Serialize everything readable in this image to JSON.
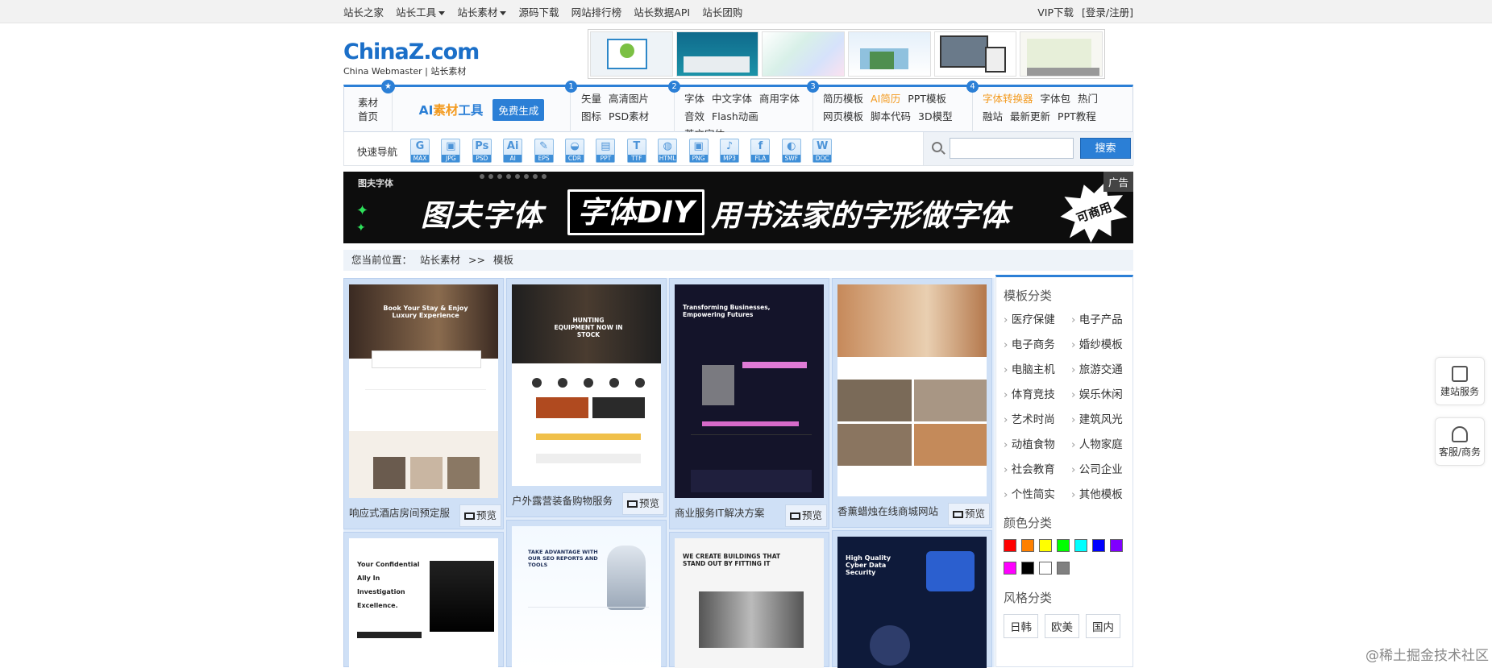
{
  "topbar": {
    "links": [
      "站长之家",
      "站长工具",
      "站长素材",
      "源码下载",
      "网站排行榜",
      "站长数据API",
      "站长团购"
    ],
    "right": [
      "VIP下载",
      "[登录/注册]"
    ]
  },
  "logo": {
    "main": "ChinaZ.com",
    "sub": "China Webmaster | 站长素材"
  },
  "catbar": {
    "home": [
      "素材",
      "首页"
    ],
    "ai_title_a": "AI",
    "ai_title_b": "素材",
    "ai_title_c": "工具",
    "ai_button": "免费生成",
    "groups": [
      {
        "num": "1",
        "rows": [
          [
            "矢量",
            "高清图片"
          ],
          [
            "图标",
            "PSD素材"
          ]
        ]
      },
      {
        "num": "2",
        "rows": [
          [
            "字体",
            "中文字体",
            "商用字体"
          ],
          [
            "音效",
            "Flash动画",
            "英文字体"
          ]
        ]
      },
      {
        "num": "3",
        "rows": [
          [
            "简历模板",
            "AI简历",
            "PPT模板"
          ],
          [
            "网页模板",
            "脚本代码",
            "3D模型"
          ]
        ]
      },
      {
        "num": "4",
        "rows": [
          [
            "字体转换器",
            "字体包",
            "热门"
          ],
          [
            "融站",
            "最新更新",
            "PPT教程"
          ]
        ]
      }
    ]
  },
  "quicknav": {
    "label": "快速导航",
    "icons": [
      "MAX",
      "JPG",
      "PSD",
      "AI",
      "EPS",
      "CDR",
      "PPT",
      "TTF",
      "HTML",
      "PNG",
      "MP3",
      "FLA",
      "SWF",
      "DOC"
    ],
    "search_button": "搜索",
    "search_placeholder": ""
  },
  "ad": {
    "tag": "广告",
    "brand": "图夫字体",
    "t1": "图夫字体",
    "t2": "字体DIY",
    "t3": "用书法家的字形做字体",
    "badge": "可商用"
  },
  "breadcrumb": {
    "prefix": "您当前位置：",
    "item1": "站长素材",
    "sep": ">>",
    "item2": "模板"
  },
  "cards": [
    {
      "title": "响应式酒店房间预定服",
      "preview": "预览"
    },
    {
      "title": "户外露营装备购物服务",
      "preview": "预览"
    },
    {
      "title": "商业服务IT解决方案",
      "preview": "预览"
    },
    {
      "title": "香薰蜡烛在线商城网站",
      "preview": "预览"
    },
    {
      "title": "",
      "preview": ""
    },
    {
      "title": "",
      "preview": ""
    },
    {
      "title": "",
      "preview": ""
    },
    {
      "title": "",
      "preview": ""
    }
  ],
  "card_texts": {
    "c1h": "Book Your Stay & Enjoy Luxury Experience",
    "c2h": "HUNTING EQUIPMENT NOW IN STOCK",
    "c3h": "Transforming Businesses, Empowering Futures",
    "c5h": "Your Confidential Ally In Investigation Excellence.",
    "c6h": "TAKE ADVANTAGE WITH OUR SEO REPORTS AND TOOLS",
    "c7h": "WE CREATE BUILDINGS THAT STAND OUT BY FITTING IT",
    "c8h": "High Quality Cyber Data Security"
  },
  "sidebar": {
    "cat_title": "模板分类",
    "cats": [
      "医疗保健",
      "电子产品",
      "电子商务",
      "婚纱模板",
      "电脑主机",
      "旅游交通",
      "体育竞技",
      "娱乐休闲",
      "艺术时尚",
      "建筑风光",
      "动植食物",
      "人物家庭",
      "社会教育",
      "公司企业",
      "个性简实",
      "其他模板"
    ],
    "color_title": "颜色分类",
    "colors": [
      "#ff0000",
      "#ff8000",
      "#ffff00",
      "#00ff00",
      "#00ffff",
      "#0000ff",
      "#8000ff",
      "#ff00ff",
      "#000000",
      "#ffffff",
      "#808080"
    ],
    "style_title": "风格分类",
    "styles": [
      "日韩",
      "欧美",
      "国内"
    ]
  },
  "floats": [
    "建站服务",
    "客服/商务"
  ],
  "watermark": "@稀土掘金技术社区"
}
